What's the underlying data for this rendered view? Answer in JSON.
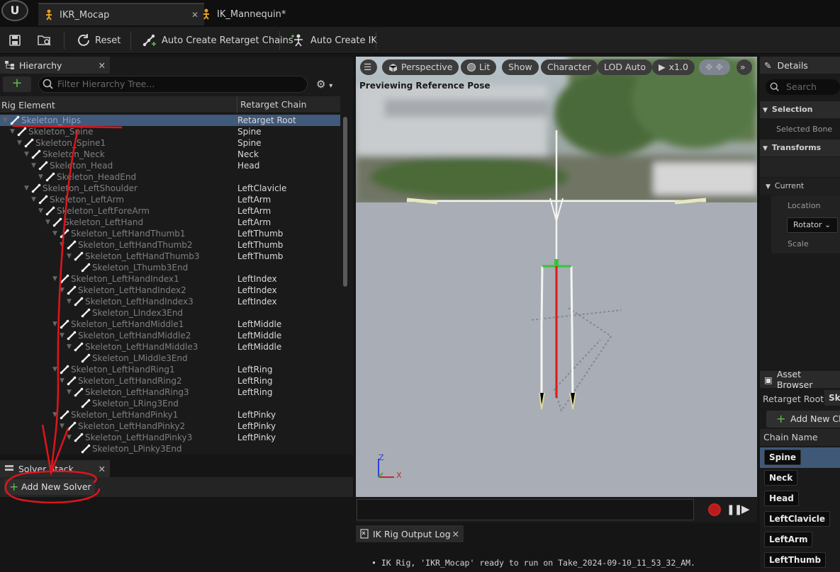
{
  "tabs": [
    {
      "label": "IKR_Mocap",
      "active": true
    },
    {
      "label": "IK_Mannequin*",
      "active": false
    }
  ],
  "toolbar": {
    "reset_label": "Reset",
    "auto_chains_label": "Auto Create Retarget Chains",
    "auto_ik_label": "Auto Create IK"
  },
  "hierarchy": {
    "title": "Hierarchy",
    "filter_placeholder": "Filter Hierarchy Tree...",
    "col_element": "Rig Element",
    "col_chain": "Retarget Chain",
    "rows": [
      {
        "name": "Skeleton_Hips",
        "chain": "Retarget Root",
        "depth": 0
      },
      {
        "name": "Skeleton_Spine",
        "chain": "Spine",
        "depth": 1
      },
      {
        "name": "Skeleton_Spine1",
        "chain": "Spine",
        "depth": 2
      },
      {
        "name": "Skeleton_Neck",
        "chain": "Neck",
        "depth": 3
      },
      {
        "name": "Skeleton_Head",
        "chain": "Head",
        "depth": 4
      },
      {
        "name": "Skeleton_HeadEnd",
        "chain": "",
        "depth": 5
      },
      {
        "name": "Skeleton_LeftShoulder",
        "chain": "LeftClavicle",
        "depth": 3
      },
      {
        "name": "Skeleton_LeftArm",
        "chain": "LeftArm",
        "depth": 4
      },
      {
        "name": "Skeleton_LeftForeArm",
        "chain": "LeftArm",
        "depth": 5
      },
      {
        "name": "Skeleton_LeftHand",
        "chain": "LeftArm",
        "depth": 6
      },
      {
        "name": "Skeleton_LeftHandThumb1",
        "chain": "LeftThumb",
        "depth": 7
      },
      {
        "name": "Skeleton_LeftHandThumb2",
        "chain": "LeftThumb",
        "depth": 8
      },
      {
        "name": "Skeleton_LeftHandThumb3",
        "chain": "LeftThumb",
        "depth": 9
      },
      {
        "name": "Skeleton_LThumb3End",
        "chain": "",
        "depth": 10
      },
      {
        "name": "Skeleton_LeftHandIndex1",
        "chain": "LeftIndex",
        "depth": 7
      },
      {
        "name": "Skeleton_LeftHandIndex2",
        "chain": "LeftIndex",
        "depth": 8
      },
      {
        "name": "Skeleton_LeftHandIndex3",
        "chain": "LeftIndex",
        "depth": 9
      },
      {
        "name": "Skeleton_LIndex3End",
        "chain": "",
        "depth": 10
      },
      {
        "name": "Skeleton_LeftHandMiddle1",
        "chain": "LeftMiddle",
        "depth": 7
      },
      {
        "name": "Skeleton_LeftHandMiddle2",
        "chain": "LeftMiddle",
        "depth": 8
      },
      {
        "name": "Skeleton_LeftHandMiddle3",
        "chain": "LeftMiddle",
        "depth": 9
      },
      {
        "name": "Skeleton_LMiddle3End",
        "chain": "",
        "depth": 10
      },
      {
        "name": "Skeleton_LeftHandRing1",
        "chain": "LeftRing",
        "depth": 7
      },
      {
        "name": "Skeleton_LeftHandRing2",
        "chain": "LeftRing",
        "depth": 8
      },
      {
        "name": "Skeleton_LeftHandRing3",
        "chain": "LeftRing",
        "depth": 9
      },
      {
        "name": "Skeleton_LRing3End",
        "chain": "",
        "depth": 10
      },
      {
        "name": "Skeleton_LeftHandPinky1",
        "chain": "LeftPinky",
        "depth": 7
      },
      {
        "name": "Skeleton_LeftHandPinky2",
        "chain": "LeftPinky",
        "depth": 8
      },
      {
        "name": "Skeleton_LeftHandPinky3",
        "chain": "LeftPinky",
        "depth": 9
      },
      {
        "name": "Skeleton_LPinky3End",
        "chain": "",
        "depth": 10
      }
    ]
  },
  "solver_stack": {
    "title": "Solver Stack",
    "add_label": "Add New Solver"
  },
  "viewport": {
    "perspective_label": "Perspective",
    "lit_label": "Lit",
    "show_label": "Show",
    "character_label": "Character",
    "lod_label": "LOD Auto",
    "speed_label": "x1.0",
    "preview_text": "Previewing Reference Pose",
    "axis_z": "Z",
    "axis_x": "X"
  },
  "output_log": {
    "title": "IK Rig Output Log",
    "line": "IK Rig, 'IKR_Mocap' ready to run on Take_2024-09-10_11_53_32_AM."
  },
  "details": {
    "title": "Details",
    "search_placeholder": "Search",
    "section_selection": "Selection",
    "selected_bone_label": "Selected Bone",
    "section_transforms": "Transforms",
    "current_label": "Current",
    "location_label": "Location",
    "rotator_label": "Rotator",
    "scale_label": "Scale"
  },
  "asset_browser": {
    "title": "Asset Browser",
    "retarget_root_label": "Retarget Root:",
    "retarget_root_value": "Sk",
    "add_chain_label": "Add New Ch",
    "chain_name_header": "Chain Name",
    "chains": [
      "Spine",
      "Neck",
      "Head",
      "LeftClavicle",
      "LeftArm",
      "LeftThumb"
    ]
  },
  "colors": {
    "selection": "#41597a",
    "accent_green": "#5ec24a",
    "annotation_red": "#e0141b"
  }
}
